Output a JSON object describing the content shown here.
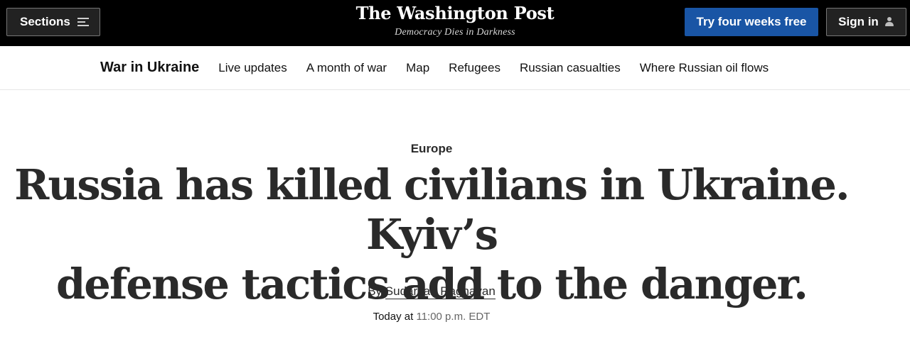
{
  "header": {
    "sections_label": "Sections",
    "logo": "The Washington Post",
    "tagline": "Democracy Dies in Darkness",
    "trial_label": "Try four weeks free",
    "signin_label": "Sign in",
    "colors": {
      "bar": "#000000",
      "trial_button": "#1955a5"
    }
  },
  "subnav": {
    "topic": "War in Ukraine",
    "links": [
      "Live updates",
      "A month of war",
      "Map",
      "Refugees",
      "Russian casualties",
      "Where Russian oil flows"
    ]
  },
  "article": {
    "section": "Europe",
    "headline_line1": "Russia has killed civilians in Ukraine. Kyiv’s",
    "headline_line2": "defense tactics add to the danger.",
    "by_prefix": "By",
    "author": "Sudarsan Raghavan",
    "date_prefix": "Today at",
    "time": "11:00 p.m. EDT"
  },
  "icons": {
    "sections": "menu-icon",
    "signin": "user-icon"
  }
}
